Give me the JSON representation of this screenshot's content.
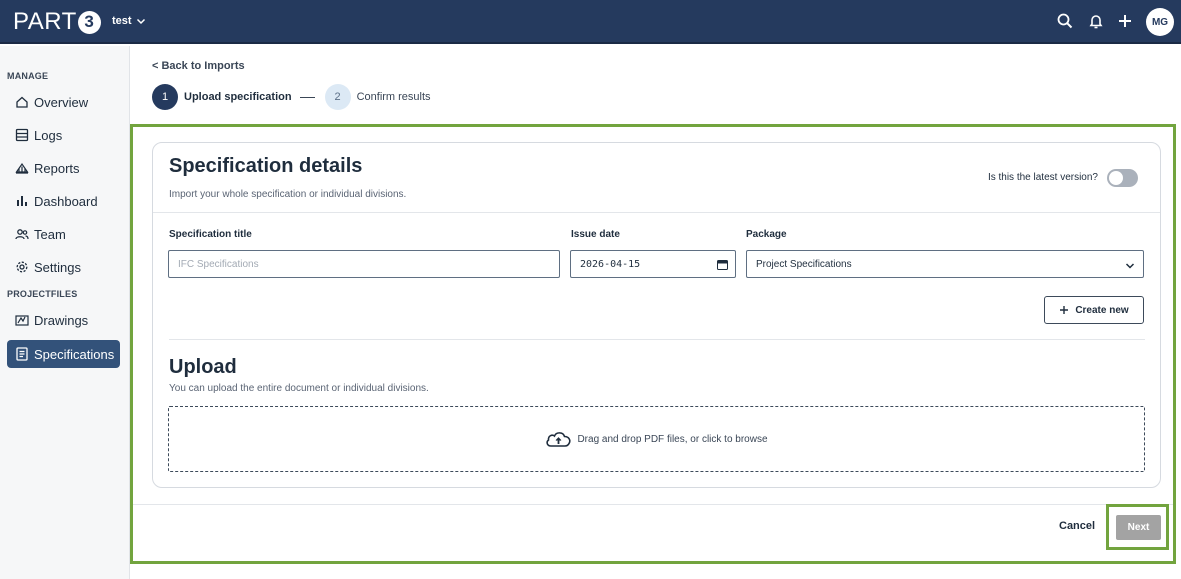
{
  "app": {
    "logo_text": "PART",
    "logo_badge": "3",
    "project_name": "test",
    "user_initials": "MG"
  },
  "topbar_icons": [
    "search-icon",
    "bell-icon",
    "plus-icon"
  ],
  "sidebar": {
    "section_manage": "MANAGE",
    "section_projectfiles": "PROJECTFILES",
    "items": [
      {
        "label": "Overview",
        "icon": "home-icon"
      },
      {
        "label": "Logs",
        "icon": "logs-icon"
      },
      {
        "label": "Reports",
        "icon": "reports-icon"
      },
      {
        "label": "Dashboard",
        "icon": "bar-chart-icon"
      },
      {
        "label": "Team",
        "icon": "team-icon"
      },
      {
        "label": "Settings",
        "icon": "gear-icon"
      },
      {
        "label": "Drawings",
        "icon": "drawings-icon"
      },
      {
        "label": "Specifications",
        "icon": "document-icon",
        "active": true
      }
    ]
  },
  "main": {
    "back_link": "< Back to Imports",
    "steps": [
      {
        "number": "1",
        "label": "Upload specification",
        "active": true
      },
      {
        "number": "2",
        "label": "Confirm results",
        "active": false
      }
    ],
    "card": {
      "title": "Specification details",
      "subtitle": "Import your whole specification or individual divisions.",
      "latest_version_label": "Is this the latest version?",
      "latest_version_on": false,
      "fields": {
        "title_label": "Specification title",
        "title_placeholder": "IFC Specifications",
        "date_label": "Issue date",
        "date_value": "2026-04-15",
        "package_label": "Package",
        "package_value": "Project Specifications"
      },
      "create_new_label": "Create new",
      "upload_title": "Upload",
      "upload_subtitle": "You can upload the entire document or individual divisions.",
      "dropzone_text": "Drag and drop PDF files, or click to browse"
    },
    "footer": {
      "cancel_label": "Cancel",
      "next_label": "Next"
    }
  },
  "colors": {
    "topbar": "#253a5e",
    "active_nav": "#33527a",
    "highlight_border": "#72a43e",
    "next_disabled": "#a3a3a3"
  }
}
